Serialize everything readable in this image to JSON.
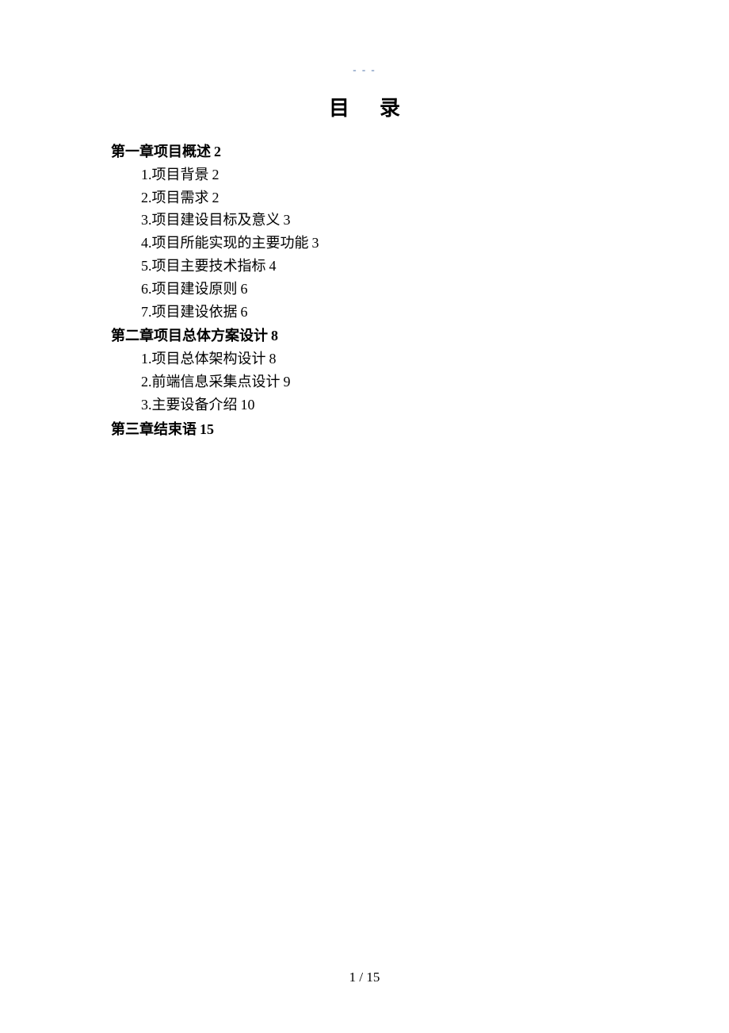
{
  "header_marker": "- - -",
  "title": "目录",
  "toc": {
    "chapters": [
      {
        "title": "第一章项目概述",
        "page": "2",
        "items": [
          {
            "label": "1.项目背景",
            "page": "2"
          },
          {
            "label": "2.项目需求",
            "page": "2"
          },
          {
            "label": "3.项目建设目标及意义",
            "page": "3"
          },
          {
            "label": "4.项目所能实现的主要功能",
            "page": "3"
          },
          {
            "label": "5.项目主要技术指标",
            "page": "4"
          },
          {
            "label": "6.项目建设原则",
            "page": "6"
          },
          {
            "label": "7.项目建设依据",
            "page": "6"
          }
        ]
      },
      {
        "title": "第二章项目总体方案设计",
        "page": "8",
        "items": [
          {
            "label": "1.项目总体架构设计",
            "page": "8"
          },
          {
            "label": "2.前端信息采集点设计",
            "page": "9"
          },
          {
            "label": "3.主要设备介绍",
            "page": "10"
          }
        ]
      },
      {
        "title": "第三章结束语",
        "page": "15",
        "items": []
      }
    ]
  },
  "footer": {
    "current": "1",
    "separator": "/",
    "total": "15"
  }
}
